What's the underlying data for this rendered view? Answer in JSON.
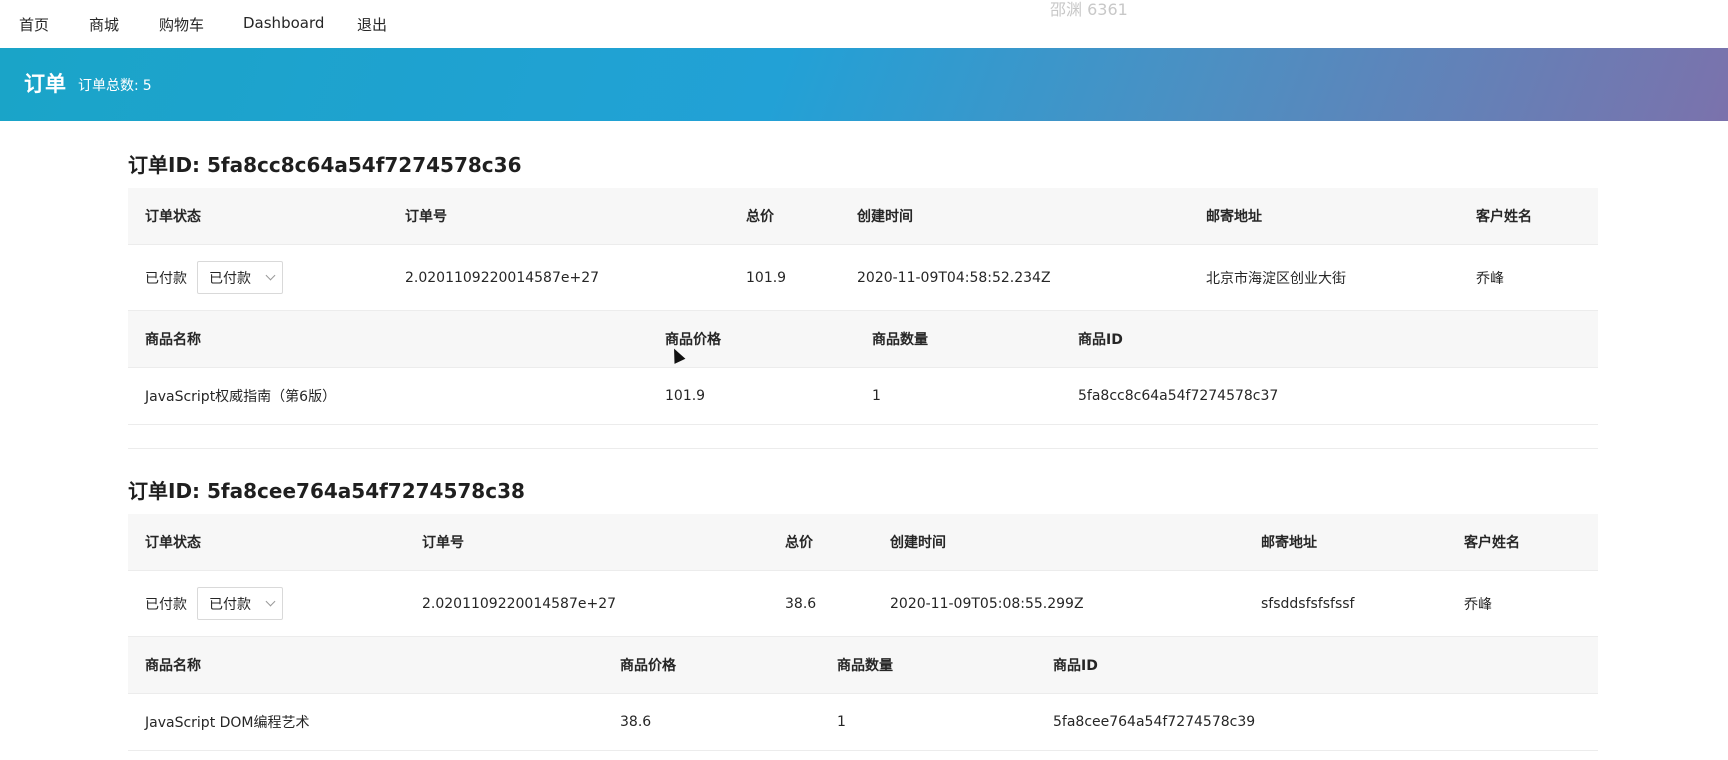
{
  "nav": {
    "items": [
      "首页",
      "商城",
      "购物车",
      "Dashboard",
      "退出"
    ],
    "watermark": "邵渊 6361"
  },
  "banner": {
    "title": "订单",
    "count_label": "订单总数:",
    "count_value": "5"
  },
  "order_columns": [
    "订单状态",
    "订单号",
    "总价",
    "创建时间",
    "邮寄地址",
    "客户姓名"
  ],
  "item_columns": [
    "商品名称",
    "商品价格",
    "商品数量",
    "商品ID"
  ],
  "orders": [
    {
      "title_prefix": "订单ID:",
      "id": "5fa8cc8c64a54f7274578c36",
      "status": "已付款",
      "status_select": "已付款",
      "order_no": "2.0201109220014587e+27",
      "total": "101.9",
      "created": "2020-11-09T04:58:52.234Z",
      "address": "北京市海淀区创业大街",
      "customer": "乔峰",
      "items": [
        {
          "name": "JavaScript权威指南（第6版）",
          "price": "101.9",
          "qty": "1",
          "id": "5fa8cc8c64a54f7274578c37"
        }
      ]
    },
    {
      "title_prefix": "订单ID:",
      "id": "5fa8cee764a54f7274578c38",
      "status": "已付款",
      "status_select": "已付款",
      "order_no": "2.0201109220014587e+27",
      "total": "38.6",
      "created": "2020-11-09T05:08:55.299Z",
      "address": "sfsddsfsfsfssf",
      "customer": "乔峰",
      "items": [
        {
          "name": "JavaScript DOM编程艺术",
          "price": "38.6",
          "qty": "1",
          "id": "5fa8cee764a54f7274578c39"
        }
      ]
    }
  ]
}
